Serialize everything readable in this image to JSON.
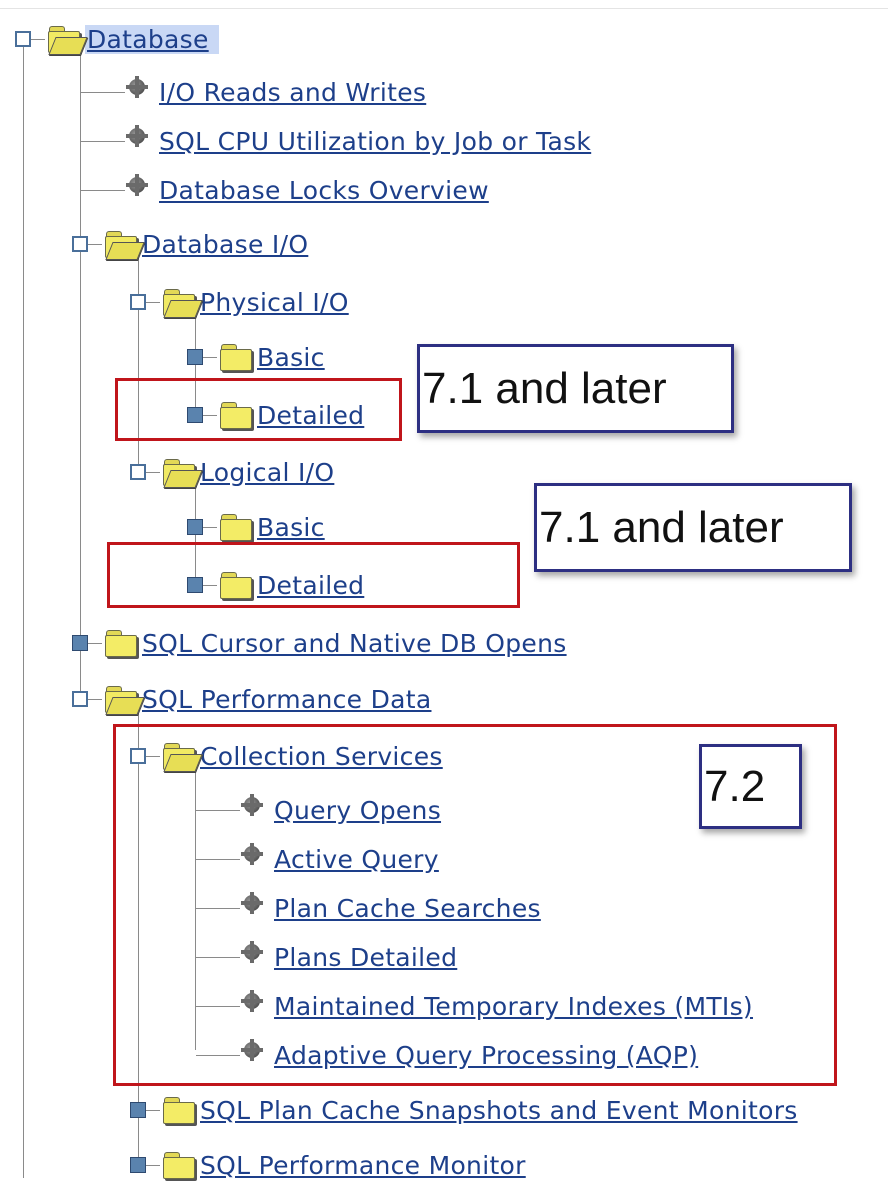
{
  "tree": {
    "root": "Database",
    "items": [
      "I/O Reads and Writes",
      "SQL CPU Utilization by Job or Task",
      "Database Locks Overview"
    ],
    "database_io": {
      "label": "Database I/O",
      "physical": {
        "label": "Physical I/O",
        "basic": "Basic",
        "detailed": "Detailed"
      },
      "logical": {
        "label": "Logical I/O",
        "basic": "Basic",
        "detailed": "Detailed"
      }
    },
    "sql_cursor": "SQL Cursor and Native DB Opens",
    "sql_performance_data": {
      "label": "SQL Performance Data",
      "collection_services": {
        "label": "Collection Services",
        "items": [
          "Query Opens",
          "Active Query",
          "Plan Cache Searches",
          "Plans Detailed",
          "Maintained Temporary Indexes (MTIs)",
          "Adaptive Query Processing (AQP)"
        ]
      },
      "plan_cache": "SQL Plan Cache Snapshots and Event Monitors",
      "performance_monitor": "SQL Performance Monitor"
    }
  },
  "annotations": {
    "physical_version": "7.1 and later",
    "logical_version": "7.1 and later",
    "collection_version": "7.2"
  },
  "colors": {
    "link": "#1d3f8a",
    "highlight_box": "#c0151b",
    "callout_border": "#2d2f82",
    "selected_bg": "#c9d8f5"
  }
}
